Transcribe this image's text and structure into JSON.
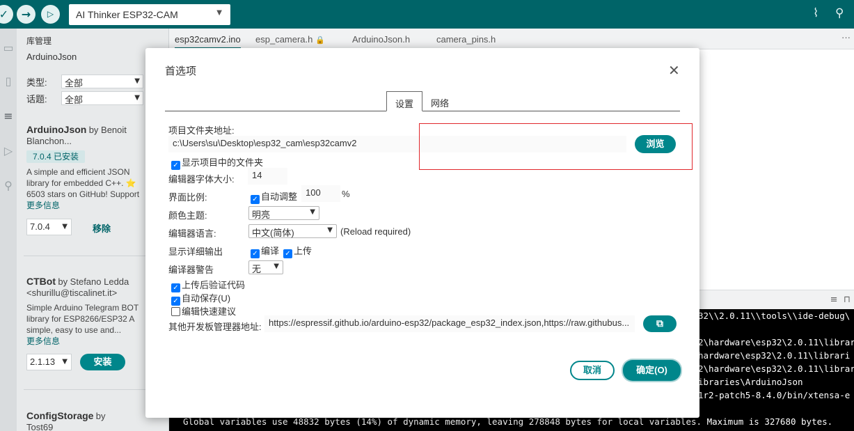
{
  "toolbar": {
    "board": "AI Thinker ESP32-CAM",
    "icons": [
      "verify-icon",
      "upload-icon",
      "debug-icon",
      "serial-plotter-icon",
      "serial-monitor-icon"
    ],
    "color": "#006468"
  },
  "library": {
    "title": "库管理",
    "search": "ArduinoJson",
    "type_label": "类型:",
    "type_value": "全部",
    "topic_label": "话题:",
    "topic_value": "全部",
    "items": [
      {
        "name": "ArduinoJson",
        "by": "by Benoit",
        "author_cont": "Blanchon...",
        "badge": "7.0.4 已安装",
        "desc": [
          "A simple and efficient JSON",
          "library for embedded C++. ⭐",
          "6503 stars on GitHub! Support"
        ],
        "more": "更多信息",
        "version": "7.0.4",
        "action": "移除"
      },
      {
        "name": "CTBot",
        "by": "by Stefano Ledda",
        "author_cont": "<shurillu@tiscalinet.it>",
        "desc": [
          "Simple Arduino Telegram BOT",
          "library for ESP8266/ESP32 A",
          "simple, easy to use and..."
        ],
        "more": "更多信息",
        "version": "2.1.13",
        "action": "安装"
      },
      {
        "name": "ConfigStorage",
        "by": "by",
        "author_cont": "Tost69"
      }
    ]
  },
  "tabs": [
    {
      "label": "esp32camv2.ino"
    },
    {
      "label": "esp_camera.h"
    },
    {
      "label": "ArduinoJson.h"
    },
    {
      "label": "camera_pins.h"
    }
  ],
  "console": {
    "lines": [
      "32\\\\2.0.11\\\\tools\\\\ide-debug\\",
      "",
      "2\\hardware\\esp32\\2.0.11\\librar",
      "hardware\\esp32\\2.0.11\\librari",
      "2\\hardware\\esp32\\2.0.11\\librar",
      "ibraries\\ArduinoJson",
      "1r2-patch5-8.4.0/bin/xtensa-e"
    ],
    "bottom_line": "Global variables use 48832 bytes (14%) of dynamic memory, leaving 278848 bytes for local variables. Maximum is 327680 bytes."
  },
  "dialog": {
    "title": "首选项",
    "tabs": [
      "设置",
      "网络"
    ],
    "sketchbook_label": "项目文件夹地址:",
    "sketchbook_path": "c:\\Users\\su\\Desktop\\esp32_cam\\esp32camv2",
    "browse": "浏览",
    "show_files": "显示项目中的文件夹",
    "font_size_label": "编辑器字体大小:",
    "font_size": "14",
    "scale_label": "界面比例:",
    "scale_auto": "自动调整",
    "scale_value": "100",
    "scale_unit": "%",
    "theme_label": "颜色主题:",
    "theme_value": "明亮",
    "language_label": "编辑器语言:",
    "language_value": "中文(简体)",
    "reload_note": "(Reload required)",
    "verbose_label": "显示详细输出",
    "verbose_compile": "编译",
    "verbose_upload": "上传",
    "warnings_label": "编译器警告",
    "warnings_value": "无",
    "verify_after_upload": "上传后验证代码",
    "auto_save": "自动保存(U)",
    "quick_suggestions": "编辑快速建议",
    "board_urls_label": "其他开发板管理器地址:",
    "board_urls": "https://espressif.github.io/arduino-esp32/package_esp32_index.json,https://raw.githubus...",
    "cancel": "取消",
    "ok": "确定(O)"
  }
}
